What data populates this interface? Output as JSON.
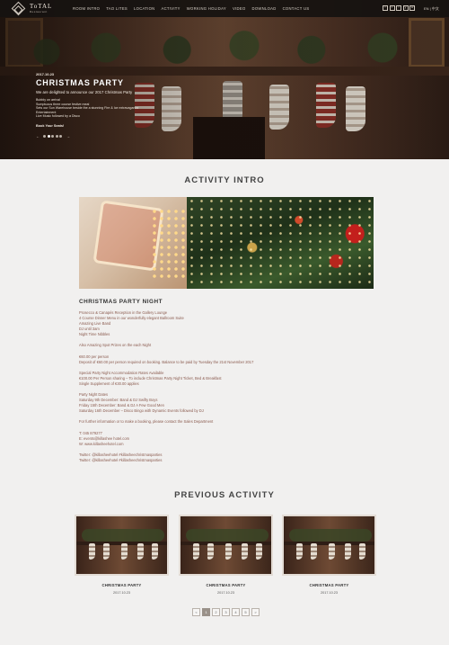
{
  "header": {
    "logo_text": "ToTAL",
    "logo_subtext": "Restaurant",
    "nav": [
      "ROOM INTRO",
      "TAO LITES",
      "LOCATION",
      "ACTIVITY",
      "WORKING HOLIDAY",
      "VIDEO",
      "DOWNLOAD",
      "CONTACT US"
    ],
    "social_icons": [
      "f",
      "t",
      "i",
      "y",
      "w"
    ],
    "lang": "EN | 中文"
  },
  "hero": {
    "date": "2017.10.23",
    "title": "CHRISTMAS PARTY",
    "lead": "We are delighted to announce our 2017 Christmas Party",
    "lines": [
      "Bubbly on arrival",
      "Sumptuous three course festive meal",
      "Sets our Sun Warehouse beside the a stunning Fire & Ice extravaganza",
      "Entertainment",
      "Live Music followed by a Disco"
    ],
    "link": "Book Your Seats!",
    "slide_count": 5,
    "active_slide": 1
  },
  "intro": {
    "heading": "ACTIVITY INTRO",
    "title": "CHRISTMAS PARTY NIGHT",
    "paragraphs": [
      [
        " Prosecco & Canapés Reception in the Gallery Lounge",
        " 4 Course Dinner Menu in our wonderfully elegant Ballroom Suite",
        " Amazing Live Band",
        " DJ until 3am",
        " Night Time Nibbles"
      ],
      [
        " Also Amazing Spot Prizes on the each Night"
      ],
      [
        "€60.00 per person",
        "Deposit of €60.00 per person required on booking.  Balance to be paid by Tuesday the 21st November 2017"
      ],
      [
        "Special Party Night Accommodation Rates Available",
        "€100.00 Per Person sharing – To include Christmas Party Night Ticket, Bed & Breakfast",
        "Single Supplement of €30.00 applies"
      ],
      [
        "Party Night Dates",
        "Saturday 9th December: Band & DJ Swifty Boys",
        "Friday 15th December: Band & DJ A Few Good Men",
        "Saturday 16th December – Disco Bingo with Dynamic Events followed by DJ"
      ],
      [
        "For further information or to make a booking, please contact the Sales Department"
      ],
      [
        "T: 045 879277",
        "E: events@killashee hotel.com",
        "W: www.killasheehotel.com"
      ],
      [
        "Twitter: @killasheehotel #killasheechristmasparties",
        "Twitter: @killasheehotel #killasheechristmasparties"
      ]
    ]
  },
  "previous": {
    "heading": "PREVIOUS ACTIVITY",
    "cards": [
      {
        "name": "CHRISTMAS PARTY",
        "date": "2017.10.23"
      },
      {
        "name": "CHRISTMAS PARTY",
        "date": "2017.10.23"
      },
      {
        "name": "CHRISTMAS PARTY",
        "date": "2017.10.23"
      }
    ],
    "pager": [
      "<",
      "1",
      "2",
      "3",
      "4",
      "5",
      ">"
    ],
    "active_page": "1"
  }
}
